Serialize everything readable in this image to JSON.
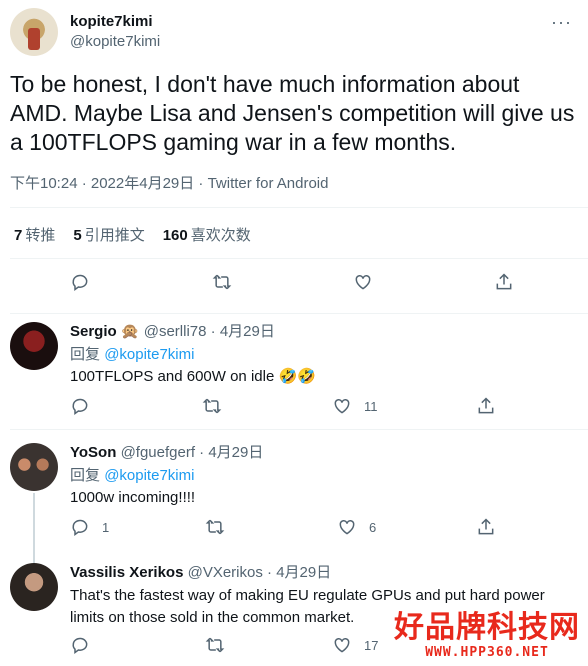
{
  "main_tweet": {
    "display_name": "kopite7kimi",
    "handle": "@kopite7kimi",
    "text": "To be honest, I don't have much information about AMD. Maybe Lisa and Jensen's competition will give us a 100TFLOPS gaming war in a few months.",
    "meta": "下午10:24 · 2022年4月29日 · Twitter for Android",
    "more_icon": "more-dots-icon",
    "stats": {
      "retweets_count": "7",
      "retweets_label": "转推",
      "quotes_count": "5",
      "quotes_label": "引用推文",
      "likes_count": "160",
      "likes_label": "喜欢次数"
    }
  },
  "replies": [
    {
      "display_name": "Sergio",
      "emoji": "🙊",
      "handle": "@serlli78",
      "date": "4月29日",
      "reply_to_label": "回复",
      "reply_to": "@kopite7kimi",
      "text": "100TFLOPS and 600W on idle 🤣🤣",
      "reply_count": "",
      "retweet_count": "",
      "like_count": "11"
    },
    {
      "display_name": "YoSon",
      "handle": "@fguefgerf",
      "date": "4月29日",
      "reply_to_label": "回复",
      "reply_to": "@kopite7kimi",
      "text": "1000w incoming!!!!",
      "reply_count": "1",
      "retweet_count": "",
      "like_count": "6"
    },
    {
      "display_name": "Vassilis Xerikos",
      "handle": "@VXerikos",
      "date": "4月29日",
      "text": "That's the fastest way of making EU regulate GPUs and put hard power limits on those sold in the common market.",
      "reply_count": "",
      "retweet_count": "",
      "like_count": "17"
    }
  ],
  "watermark": {
    "title": "好品牌科技网",
    "url": "WWW.HPP360.NET"
  },
  "colors": {
    "accent": "#1d9bf0",
    "text": "#0f1419",
    "secondary": "#536471",
    "watermark": "#e8291c"
  }
}
